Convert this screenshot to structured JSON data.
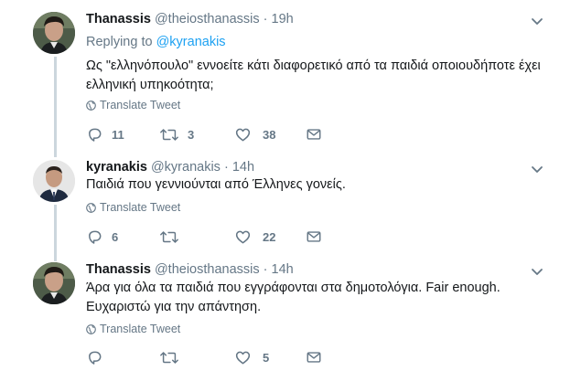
{
  "tweets": [
    {
      "name": "Thanassis",
      "handle": "@theiosthanassis",
      "separator": "·",
      "time": "19h",
      "reply_label": "Replying to",
      "reply_mention": "@kyranakis",
      "text": "Ως \"ελληνόπουλο\" εννοείτε κάτι διαφορετικό από τα παιδιά οποιουδήποτε έχει ελληνική υπηκοότητα;",
      "translate": "Translate Tweet",
      "replies": "11",
      "retweets": "3",
      "likes": "38"
    },
    {
      "name": "kyranakis",
      "handle": "@kyranakis",
      "separator": "·",
      "time": "14h",
      "text": "Παιδιά που γεννιούνται από Έλληνες γονείς.",
      "translate": "Translate Tweet",
      "replies": "6",
      "retweets": "",
      "likes": "22"
    },
    {
      "name": "Thanassis",
      "handle": "@theiosthanassis",
      "separator": "·",
      "time": "14h",
      "text_line1": "Άρα για όλα τα παιδιά που εγγράφονται στα δημοτολόγια. Fair enough.",
      "text_line2": "Ευχαριστώ για την απάντηση.",
      "translate": "Translate Tweet",
      "replies": "",
      "retweets": "",
      "likes": "5"
    }
  ],
  "icons": {
    "reply": "reply-icon",
    "retweet": "retweet-icon",
    "like": "heart-icon",
    "message": "envelope-icon",
    "translate": "globe-icon",
    "caret": "chevron-down-icon"
  },
  "colors": {
    "text": "#14171a",
    "secondary": "#657786",
    "link": "#1da1f2",
    "thread_line": "#ccd6dd"
  }
}
